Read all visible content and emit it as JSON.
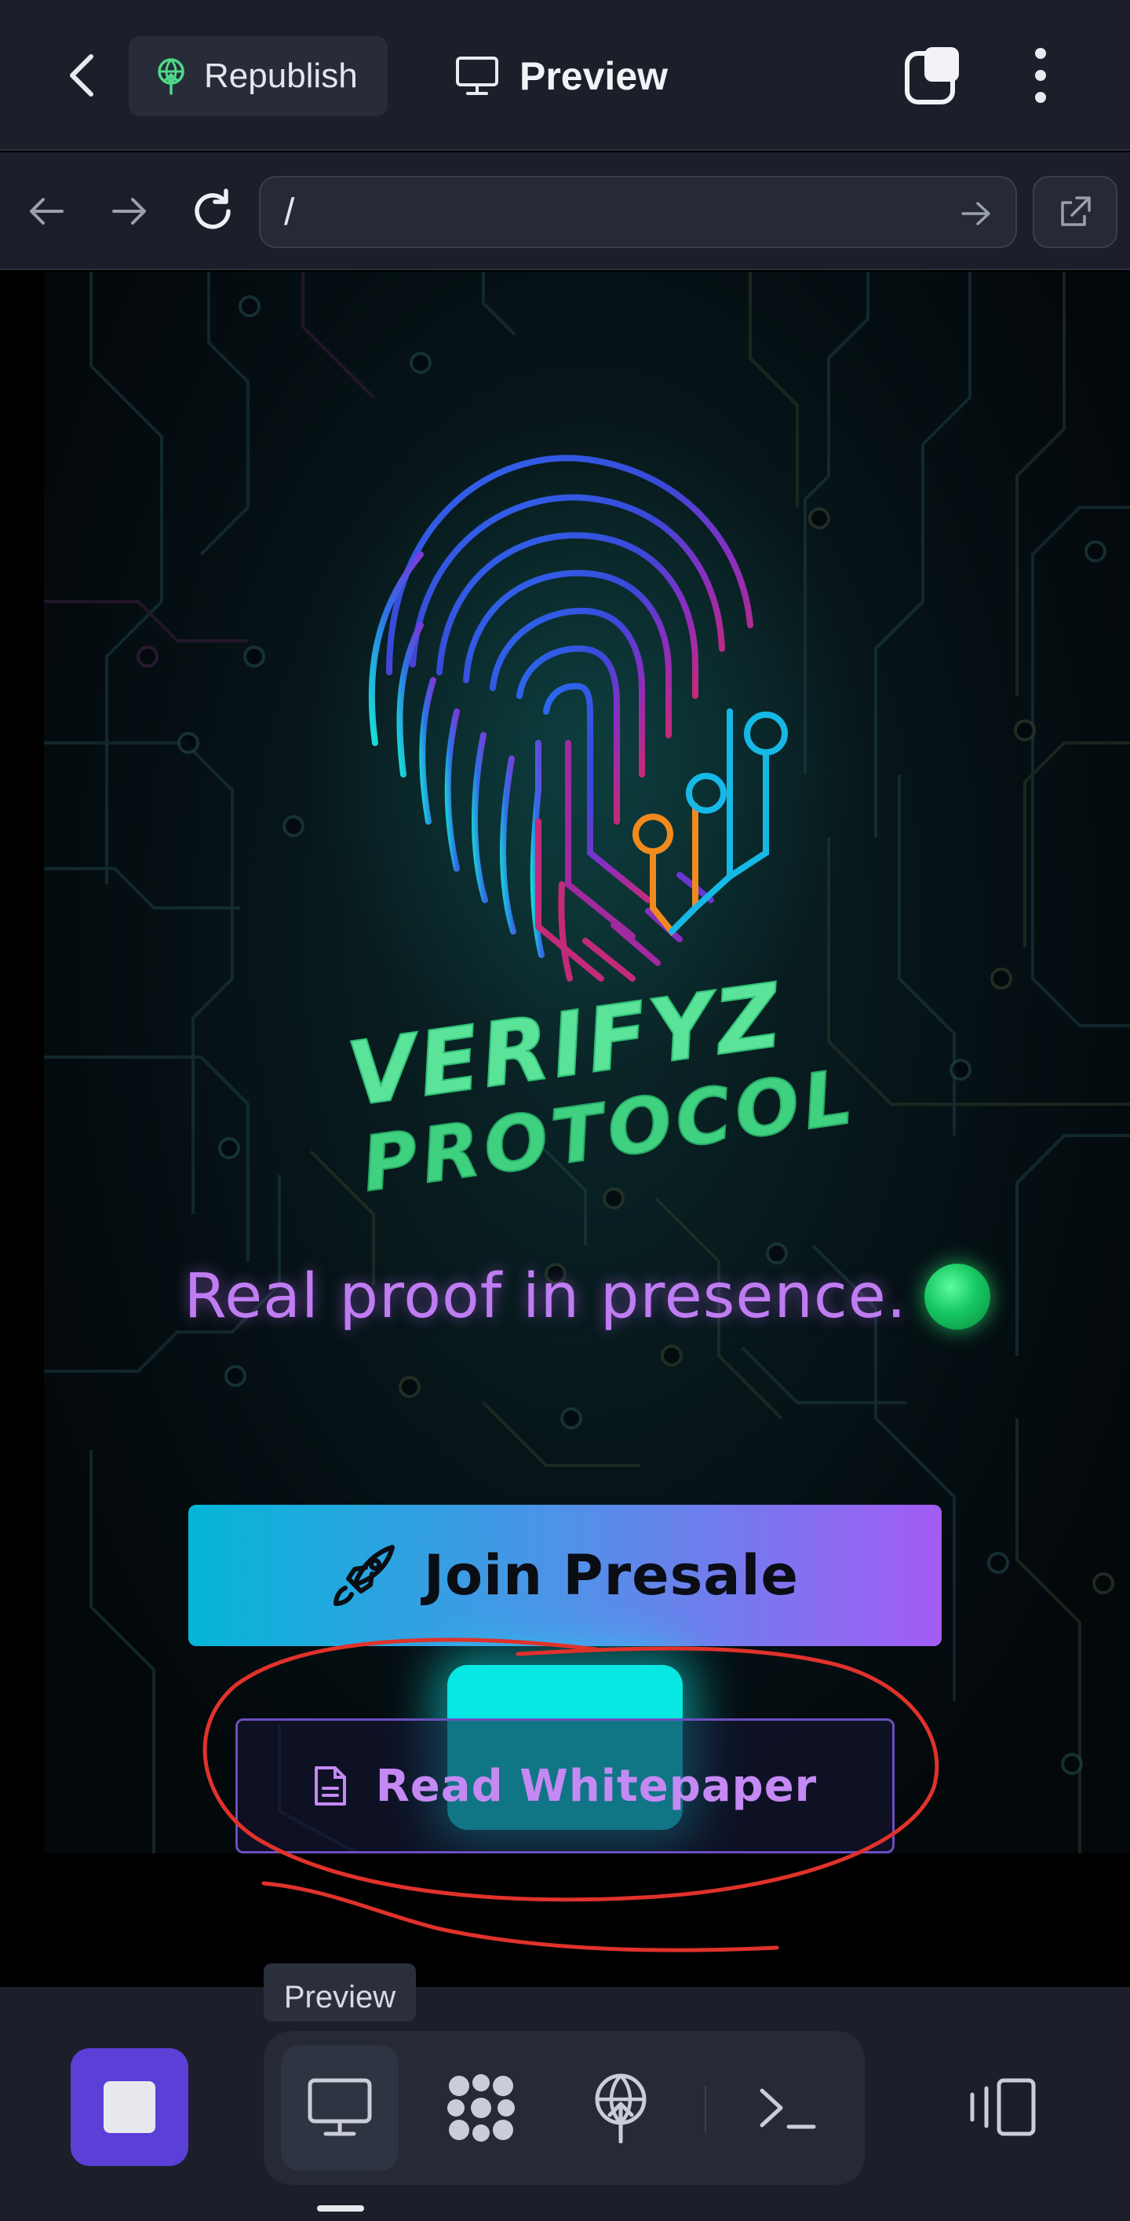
{
  "appbar": {
    "republish_label": "Republish",
    "preview_label": "Preview"
  },
  "browser": {
    "url": "/"
  },
  "site": {
    "logo_line1": "VERIFYZ",
    "logo_line2": "PROTOCOL",
    "tagline": "Real proof in presence.",
    "join_label": "Join Presale",
    "whitepaper_label": "Read Whitepaper"
  },
  "bottombar": {
    "tooltip": "Preview"
  },
  "colors": {
    "accent_purple": "#5b3fd6",
    "tagline": "#c07cf2",
    "logo_green": "#5be39a",
    "annotation_red": "#e0322b"
  },
  "icons": [
    "back-icon",
    "republish-icon",
    "monitor-icon",
    "tabs-icon",
    "kebab-icon",
    "arrow-left-icon",
    "arrow-right-icon",
    "reload-icon",
    "url-go-icon",
    "open-external-icon",
    "rocket-icon",
    "document-icon",
    "stop-icon",
    "apps-icon",
    "deploy-icon",
    "terminal-icon",
    "devices-icon"
  ]
}
